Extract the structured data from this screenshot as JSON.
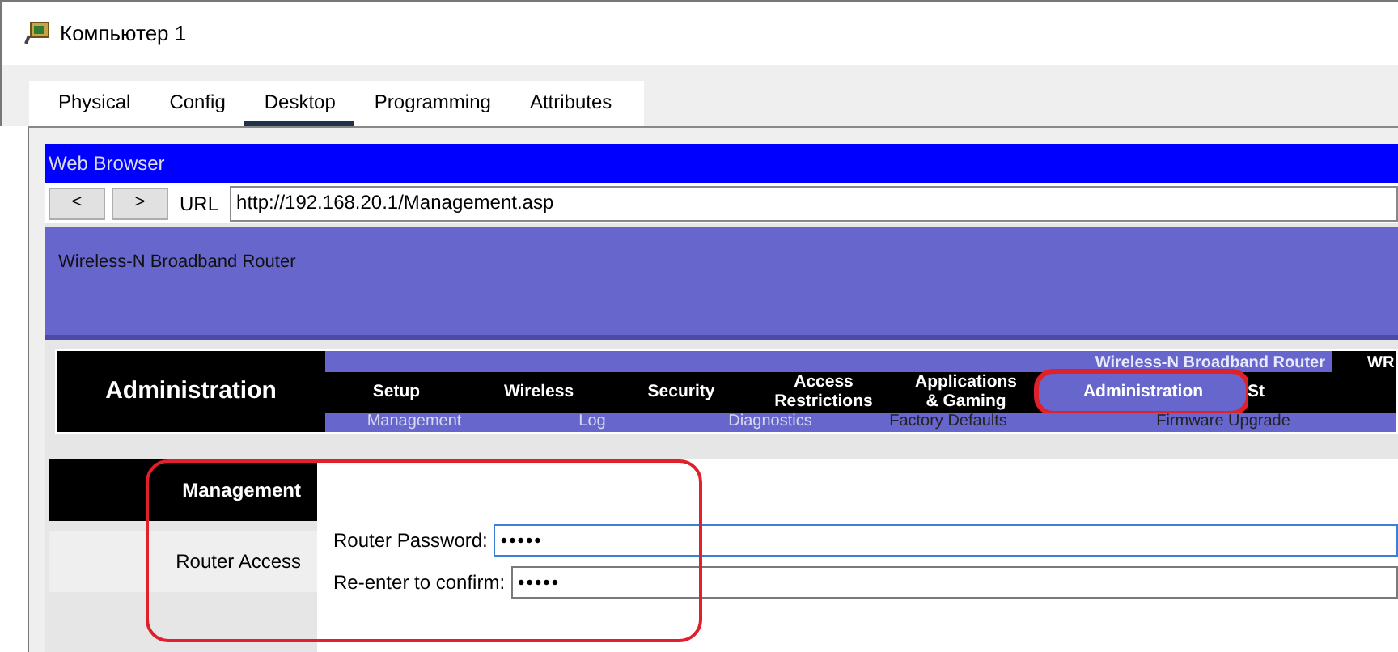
{
  "window": {
    "title": "Компьютер 1"
  },
  "tabs": [
    {
      "label": "Physical",
      "selected": false
    },
    {
      "label": "Config",
      "selected": false
    },
    {
      "label": "Desktop",
      "selected": true
    },
    {
      "label": "Programming",
      "selected": false
    },
    {
      "label": "Attributes",
      "selected": false
    }
  ],
  "browser": {
    "title": "Web Browser",
    "back": "<",
    "forward": ">",
    "url_label": "URL",
    "url": "http://192.168.20.1/Management.asp"
  },
  "router_page": {
    "header_title": "Wireless-N Broadband Router",
    "section_title": "Administration",
    "product_name": "Wireless-N Broadband Router",
    "model": "WR",
    "menu": [
      {
        "label": "Setup",
        "selected": false,
        "highlighted": false
      },
      {
        "label": "Wireless",
        "selected": false,
        "highlighted": false
      },
      {
        "label": "Security",
        "selected": false,
        "highlighted": false
      },
      {
        "label": "Access\nRestrictions",
        "selected": false,
        "highlighted": false
      },
      {
        "label": "Applications\n& Gaming",
        "selected": false,
        "highlighted": false
      },
      {
        "label": "Administration",
        "selected": true,
        "highlighted": true
      },
      {
        "label": "St",
        "selected": false,
        "highlighted": false
      }
    ],
    "submenu": [
      {
        "label": "Management",
        "dimmed": true
      },
      {
        "label": "Log",
        "dimmed": true
      },
      {
        "label": "Diagnostics",
        "dimmed": true
      },
      {
        "label": "Factory Defaults",
        "dimmed": false
      },
      {
        "label": "Firmware Upgrade",
        "dimmed": false
      }
    ],
    "side_menu": [
      {
        "label": "Management",
        "selected": true
      },
      {
        "label": "Router Access",
        "selected": false
      }
    ],
    "form": {
      "highlighted": true,
      "fields": [
        {
          "label": "Router Password:",
          "value": "•••••",
          "focused": true
        },
        {
          "label": "Re-enter to confirm:",
          "value": "•••••",
          "focused": false
        }
      ]
    }
  }
}
